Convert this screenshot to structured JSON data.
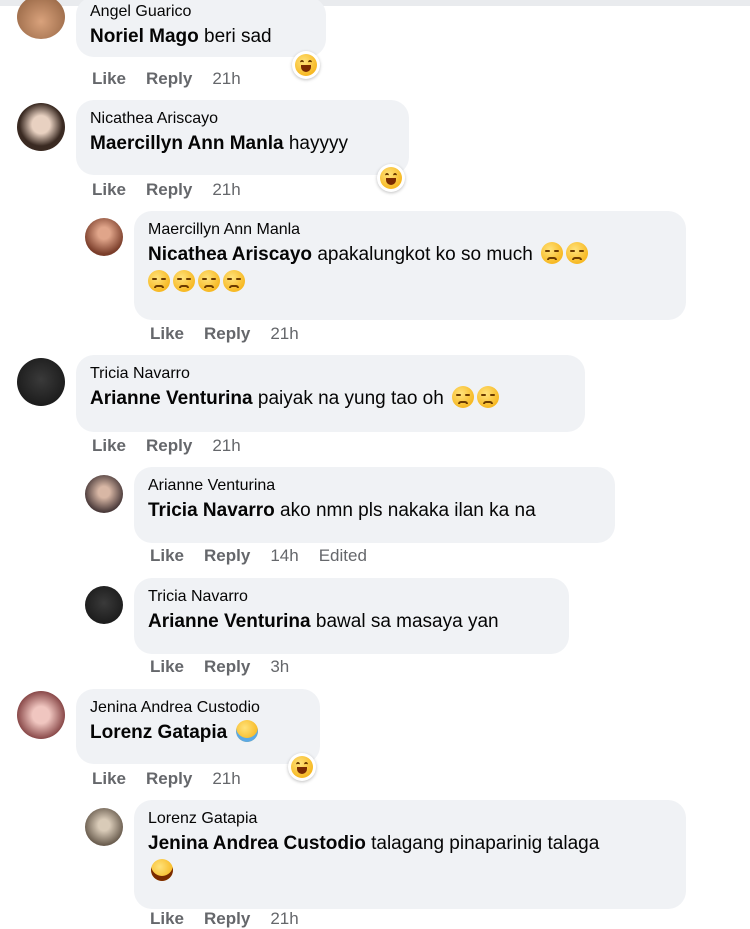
{
  "comments": [
    {
      "author": "Angel Guarico",
      "mention": "Noriel Mago",
      "text": "beri sad",
      "emojis": [],
      "actions": [
        "Like",
        "Reply"
      ],
      "time": "21h",
      "edited": ""
    },
    {
      "author": "Nicathea Ariscayo",
      "mention": "Maercillyn Ann Manla",
      "text": "hayyyy",
      "emojis": [],
      "actions": [
        "Like",
        "Reply"
      ],
      "time": "21h",
      "edited": ""
    },
    {
      "author": "Maercillyn Ann Manla",
      "mention": "Nicathea Ariscayo",
      "text": "apakalungkot ko so much",
      "emojis": [
        "sad",
        "sad",
        "sad",
        "sad",
        "sad",
        "sad"
      ],
      "actions": [
        "Like",
        "Reply"
      ],
      "time": "21h",
      "edited": ""
    },
    {
      "author": "Tricia Navarro",
      "mention": "Arianne Venturina",
      "text": "paiyak na yung tao oh",
      "emojis": [
        "sad",
        "sad"
      ],
      "actions": [
        "Like",
        "Reply"
      ],
      "time": "21h",
      "edited": ""
    },
    {
      "author": "Arianne Venturina",
      "mention": "Tricia Navarro",
      "text": "ako nmn pls nakaka ilan ka na",
      "emojis": [],
      "actions": [
        "Like",
        "Reply"
      ],
      "time": "14h",
      "edited": "Edited"
    },
    {
      "author": "Tricia Navarro",
      "mention": "Arianne Venturina",
      "text": "bawal sa masaya yan",
      "emojis": [],
      "actions": [
        "Like",
        "Reply"
      ],
      "time": "3h",
      "edited": ""
    },
    {
      "author": "Jenina Andrea Custodio",
      "mention": "Lorenz Gatapia",
      "text": "",
      "emojis": [
        "crying"
      ],
      "actions": [
        "Like",
        "Reply"
      ],
      "time": "21h",
      "edited": ""
    },
    {
      "author": "Lorenz Gatapia",
      "mention": "Jenina Andrea Custodio",
      "text": "talagang pinaparinig talaga",
      "emojis": [
        "laughing"
      ],
      "actions": [
        "Like",
        "Reply"
      ],
      "time": "21h",
      "edited": ""
    }
  ],
  "reaction_icon": "haha-reaction-icon",
  "colors": {
    "bubble": "#f0f2f5",
    "meta": "#65676b",
    "text": "#050505"
  }
}
